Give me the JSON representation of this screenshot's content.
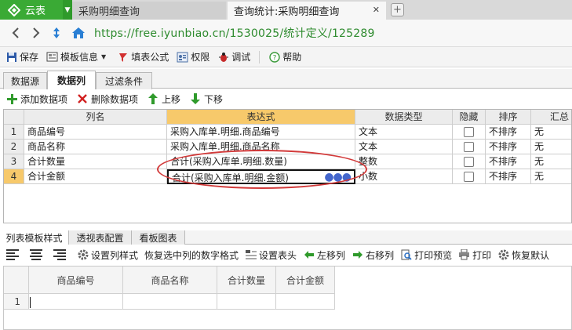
{
  "browser": {
    "app_name": "云表",
    "tabs": [
      {
        "label": "采购明细查询",
        "active": false
      },
      {
        "label": "查询统计:采购明细查询",
        "active": true
      }
    ],
    "url": "https://free.iyunbiao.cn/1530025/统计定义/125289"
  },
  "toolbar": {
    "save": "保存",
    "template_info": "模板信息",
    "fill_formula": "填表公式",
    "permission": "权限",
    "debug": "调试",
    "help": "帮助"
  },
  "inner_tabs": [
    "数据源",
    "数据列",
    "过滤条件"
  ],
  "column_toolbar": {
    "add": "添加数据项",
    "delete": "删除数据项",
    "up": "上移",
    "down": "下移"
  },
  "grid": {
    "headers": [
      "列名",
      "表达式",
      "数据类型",
      "隐藏",
      "排序",
      "汇总"
    ],
    "rows": [
      {
        "num": "1",
        "name": "商品编号",
        "expr": "采购入库单.明细.商品编号",
        "type": "文本",
        "hidden": false,
        "sort": "不排序",
        "summary": "无"
      },
      {
        "num": "2",
        "name": "商品名称",
        "expr": "采购入库单.明细.商品名称",
        "type": "文本",
        "hidden": false,
        "sort": "不排序",
        "summary": "无"
      },
      {
        "num": "3",
        "name": "合计数量",
        "expr": "合计(采购入库单.明细.数量)",
        "type": "整数",
        "hidden": false,
        "sort": "不排序",
        "summary": "无"
      },
      {
        "num": "4",
        "name": "合计金额",
        "expr": "合计(采购入库单.明细.金额)",
        "type": "小数",
        "hidden": false,
        "sort": "不排序",
        "summary": "无"
      }
    ]
  },
  "bottom_tabs": [
    "列表模板样式",
    "透视表配置",
    "看板图表"
  ],
  "style_toolbar": {
    "set_column_style": "设置列样式",
    "restore_number_format": "恢复选中列的数字格式",
    "set_header": "设置表头",
    "move_left": "左移列",
    "move_right": "右移列",
    "print_preview": "打印预览",
    "print": "打印",
    "restore_default": "恢复默认"
  },
  "preview": {
    "headers": [
      "商品编号",
      "商品名称",
      "合计数量",
      "合计金额"
    ],
    "row_num": "1"
  },
  "colors": {
    "brand_green": "#3aaa35",
    "selection_orange": "#f7c96b",
    "annotation_red": "#d23a3a"
  }
}
